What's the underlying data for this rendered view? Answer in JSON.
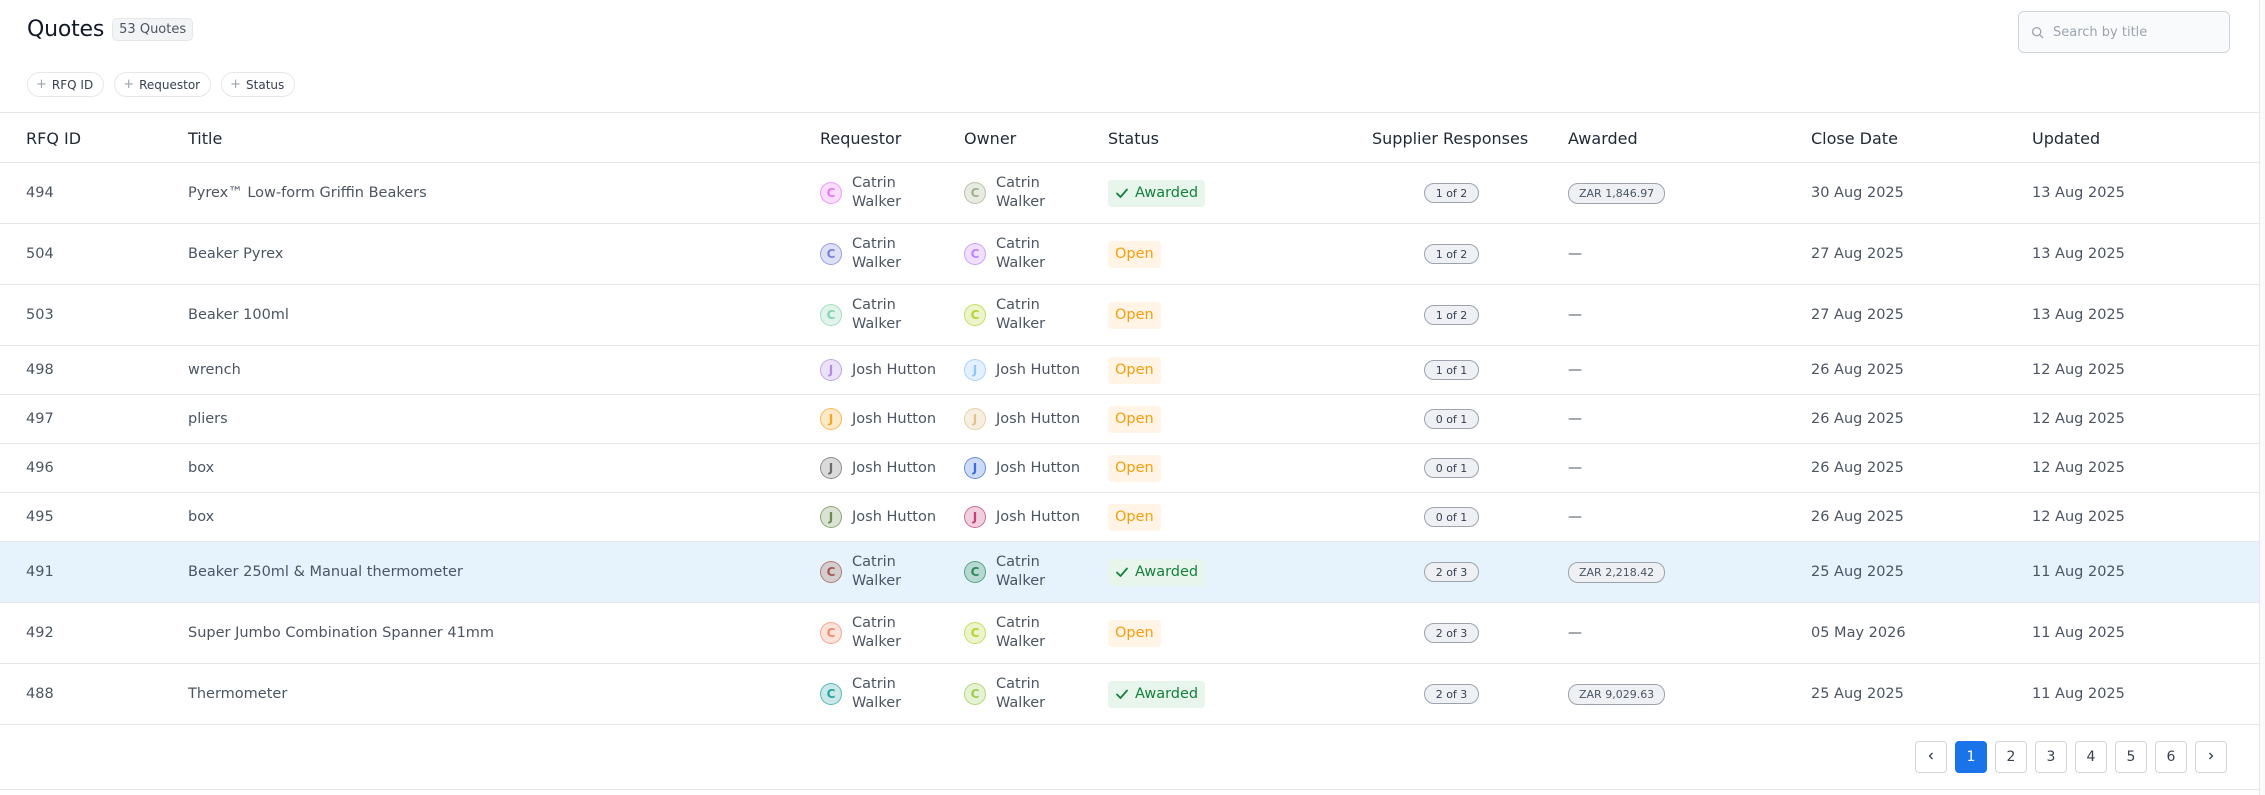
{
  "header": {
    "title": "Quotes",
    "count": "53 Quotes",
    "search_placeholder": "Search by title"
  },
  "filters": [
    "RFQ ID",
    "Requestor",
    "Status"
  ],
  "columns": {
    "rfq_id": "RFQ ID",
    "title": "Title",
    "requestor": "Requestor",
    "owner": "Owner",
    "status": "Status",
    "supplier_responses": "Supplier Responses",
    "awarded": "Awarded",
    "close_date": "Close Date",
    "updated": "Updated"
  },
  "rows": [
    {
      "id": "494",
      "title": "Pyrex™ Low-form Griffin Beakers",
      "requestor": {
        "name": "Catrin Walker",
        "initial": "C",
        "color": "#e879f9"
      },
      "owner": {
        "name": "Catrin Walker",
        "initial": "C",
        "color": "#a3b18a"
      },
      "status": "Awarded",
      "responses": "1 of 2",
      "awarded": "ZAR 1,846.97",
      "close": "30 Aug 2025",
      "updated": "13 Aug 2025",
      "selected": false
    },
    {
      "id": "504",
      "title": "Beaker Pyrex",
      "requestor": {
        "name": "Catrin Walker",
        "initial": "C",
        "color": "#7c83db"
      },
      "owner": {
        "name": "Catrin Walker",
        "initial": "C",
        "color": "#c084fc"
      },
      "status": "Open",
      "responses": "1 of 2",
      "awarded": "—",
      "close": "27 Aug 2025",
      "updated": "13 Aug 2025",
      "selected": false
    },
    {
      "id": "503",
      "title": "Beaker 100ml",
      "requestor": {
        "name": "Catrin Walker",
        "initial": "C",
        "color": "#86d3b0"
      },
      "owner": {
        "name": "Catrin Walker",
        "initial": "C",
        "color": "#b5d334"
      },
      "status": "Open",
      "responses": "1 of 2",
      "awarded": "—",
      "close": "27 Aug 2025",
      "updated": "13 Aug 2025",
      "selected": false
    },
    {
      "id": "498",
      "title": "wrench",
      "requestor": {
        "name": "Josh Hutton",
        "initial": "J",
        "color": "#b18ae0"
      },
      "owner": {
        "name": "Josh Hutton",
        "initial": "J",
        "color": "#93c5fd"
      },
      "status": "Open",
      "responses": "1 of 1",
      "awarded": "—",
      "close": "26 Aug 2025",
      "updated": "12 Aug 2025",
      "selected": false
    },
    {
      "id": "497",
      "title": "pliers",
      "requestor": {
        "name": "Josh Hutton",
        "initial": "J",
        "color": "#f5a623"
      },
      "owner": {
        "name": "Josh Hutton",
        "initial": "J",
        "color": "#e0c28a"
      },
      "status": "Open",
      "responses": "0 of 1",
      "awarded": "—",
      "close": "26 Aug 2025",
      "updated": "12 Aug 2025",
      "selected": false
    },
    {
      "id": "496",
      "title": "box",
      "requestor": {
        "name": "Josh Hutton",
        "initial": "J",
        "color": "#6b6b6b"
      },
      "owner": {
        "name": "Josh Hutton",
        "initial": "J",
        "color": "#3b6fd8"
      },
      "status": "Open",
      "responses": "0 of 1",
      "awarded": "—",
      "close": "26 Aug 2025",
      "updated": "12 Aug 2025",
      "selected": false
    },
    {
      "id": "495",
      "title": "box",
      "requestor": {
        "name": "Josh Hutton",
        "initial": "J",
        "color": "#6b8e4e"
      },
      "owner": {
        "name": "Josh Hutton",
        "initial": "J",
        "color": "#c2417a"
      },
      "status": "Open",
      "responses": "0 of 1",
      "awarded": "—",
      "close": "26 Aug 2025",
      "updated": "12 Aug 2025",
      "selected": false
    },
    {
      "id": "491",
      "title": "Beaker 250ml & Manual thermometer",
      "requestor": {
        "name": "Catrin Walker",
        "initial": "C",
        "color": "#a05a4a"
      },
      "owner": {
        "name": "Catrin Walker",
        "initial": "C",
        "color": "#2e8b57"
      },
      "status": "Awarded",
      "responses": "2 of 3",
      "awarded": "ZAR 2,218.42",
      "close": "25 Aug 2025",
      "updated": "11 Aug 2025",
      "selected": true
    },
    {
      "id": "492",
      "title": "Super Jumbo Combination Spanner 41mm",
      "requestor": {
        "name": "Catrin Walker",
        "initial": "C",
        "color": "#f08c6c"
      },
      "owner": {
        "name": "Catrin Walker",
        "initial": "C",
        "color": "#b5d334"
      },
      "status": "Open",
      "responses": "2 of 3",
      "awarded": "—",
      "close": "05 May 2026",
      "updated": "11 Aug 2025",
      "selected": false
    },
    {
      "id": "488",
      "title": "Thermometer",
      "requestor": {
        "name": "Catrin Walker",
        "initial": "C",
        "color": "#2aa3a3"
      },
      "owner": {
        "name": "Catrin Walker",
        "initial": "C",
        "color": "#9acd50"
      },
      "status": "Awarded",
      "responses": "2 of 3",
      "awarded": "ZAR 9,029.63",
      "close": "25 Aug 2025",
      "updated": "11 Aug 2025",
      "selected": false
    }
  ],
  "pagination": {
    "prev_icon": "chevron-left-icon",
    "next_icon": "chevron-right-icon",
    "pages": [
      "1",
      "2",
      "3",
      "4",
      "5",
      "6"
    ],
    "current": "1"
  },
  "colors": {
    "accent": "#1a73e8",
    "awarded_text": "#15803d",
    "awarded_bg": "#e7f5ec",
    "open_text": "#f59e0b",
    "open_bg": "#fff4e5",
    "selected_row": "#e6f3fc"
  }
}
